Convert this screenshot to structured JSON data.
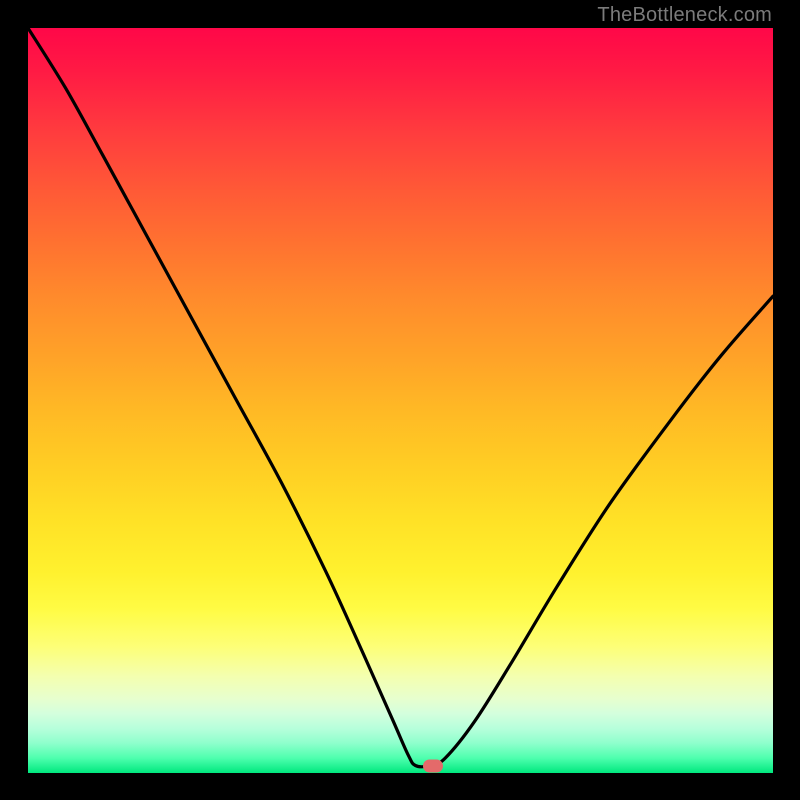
{
  "watermark": {
    "text": "TheBottleneck.com"
  },
  "marker": {
    "color": "#e46a6a",
    "x_frac": 0.544,
    "y_frac": 0.991
  },
  "chart_data": {
    "type": "line",
    "title": "",
    "xlabel": "",
    "ylabel": "",
    "xlim": [
      0,
      1
    ],
    "ylim": [
      0,
      1
    ],
    "grid": false,
    "legend": false,
    "background": "vertical-gradient red→orange→yellow→green",
    "series": [
      {
        "name": "bottleneck-curve",
        "color": "#000000",
        "x": [
          0.0,
          0.05,
          0.1,
          0.16,
          0.22,
          0.28,
          0.34,
          0.4,
          0.45,
          0.49,
          0.51,
          0.52,
          0.54,
          0.56,
          0.6,
          0.65,
          0.71,
          0.78,
          0.86,
          0.93,
          1.0
        ],
        "y": [
          1.0,
          0.92,
          0.83,
          0.72,
          0.61,
          0.5,
          0.39,
          0.27,
          0.16,
          0.07,
          0.025,
          0.01,
          0.01,
          0.02,
          0.07,
          0.15,
          0.25,
          0.36,
          0.47,
          0.56,
          0.64
        ]
      }
    ],
    "annotations": [
      {
        "type": "pill-marker",
        "x": 0.544,
        "y": 0.009,
        "color": "#e46a6a"
      }
    ]
  }
}
